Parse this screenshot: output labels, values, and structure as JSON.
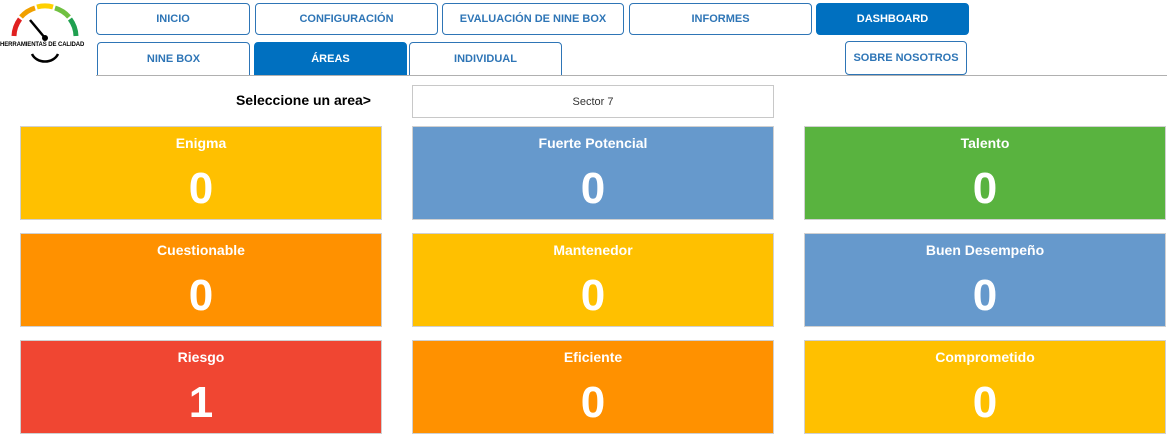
{
  "logo": {
    "text": "HERRAMIENTAS DE CALIDAD"
  },
  "nav": {
    "top": [
      {
        "label": "INICIO",
        "active": false
      },
      {
        "label": "CONFIGURACIÓN",
        "active": false
      },
      {
        "label": "EVALUACIÓN DE NINE BOX",
        "active": false
      },
      {
        "label": "INFORMES",
        "active": false
      },
      {
        "label": "DASHBOARD",
        "active": true
      }
    ],
    "sub": [
      {
        "label": "NINE BOX",
        "active": false
      },
      {
        "label": "ÁREAS",
        "active": true
      },
      {
        "label": "INDIVIDUAL",
        "active": false
      }
    ],
    "about": {
      "label": "SOBRE NOSOTROS"
    }
  },
  "area_selector": {
    "label": "Seleccione un area>",
    "value": "Sector 7"
  },
  "cards": [
    {
      "title": "Enigma",
      "value": "0",
      "color": "#ffc000"
    },
    {
      "title": "Fuerte Potencial",
      "value": "0",
      "color": "#6699cc"
    },
    {
      "title": "Talento",
      "value": "0",
      "color": "#59b33f"
    },
    {
      "title": "Cuestionable",
      "value": "0",
      "color": "#ff9100"
    },
    {
      "title": "Mantenedor",
      "value": "0",
      "color": "#ffc000"
    },
    {
      "title": "Buen Desempeño",
      "value": "0",
      "color": "#6699cc"
    },
    {
      "title": "Riesgo",
      "value": "1",
      "color": "#f04632"
    },
    {
      "title": "Eficiente",
      "value": "0",
      "color": "#ff9100"
    },
    {
      "title": "Comprometido",
      "value": "0",
      "color": "#ffc000"
    }
  ],
  "colors": {
    "accent": "#0070c0",
    "nav_border": "#2e75b6"
  }
}
